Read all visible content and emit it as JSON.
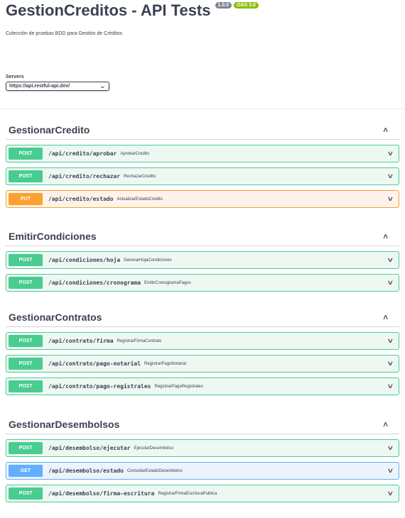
{
  "info": {
    "title": "GestionCreditos - API Tests",
    "version": "1.0.0",
    "oas": "OAS 3.0",
    "description": "Colección de pruebas BDD para Gestión de Créditos"
  },
  "servers": {
    "label": "Servers",
    "selected": "https://api.restful-api.dev/"
  },
  "colors": {
    "post": "#49cc90",
    "put": "#fca130",
    "get": "#61affe"
  },
  "tags": [
    {
      "name": "GestionarCredito",
      "operations": [
        {
          "method": "POST",
          "path": "/api/credito/aprobar",
          "summary": "AprobarCredito"
        },
        {
          "method": "POST",
          "path": "/api/credito/rechazar",
          "summary": "RechazarCredito"
        },
        {
          "method": "PUT",
          "path": "/api/credito/estado",
          "summary": "ActualizarEstadoCredito"
        }
      ]
    },
    {
      "name": "EmitirCondiciones",
      "operations": [
        {
          "method": "POST",
          "path": "/api/condiciones/hoja",
          "summary": "GenerarHojaCondiciones"
        },
        {
          "method": "POST",
          "path": "/api/condiciones/cronograma",
          "summary": "EmitirCronogramaPagos"
        }
      ]
    },
    {
      "name": "GestionarContratos",
      "operations": [
        {
          "method": "POST",
          "path": "/api/contrato/firma",
          "summary": "RegistrarFirmaContrato"
        },
        {
          "method": "POST",
          "path": "/api/contrato/pago-notarial",
          "summary": "RegistrarPagoNotarial"
        },
        {
          "method": "POST",
          "path": "/api/contrato/pago-registrales",
          "summary": "RegistrarPagoRegistrales"
        }
      ]
    },
    {
      "name": "GestionarDesembolsos",
      "operations": [
        {
          "method": "POST",
          "path": "/api/desembolso/ejecutar",
          "summary": "EjecutarDesembolso"
        },
        {
          "method": "GET",
          "path": "/api/desembolso/estado",
          "summary": "ConsultarEstadoDesembolso"
        },
        {
          "method": "POST",
          "path": "/api/desembolso/firma-escritura",
          "summary": "RegistrarFirmaEscrituraPublica"
        }
      ]
    }
  ]
}
